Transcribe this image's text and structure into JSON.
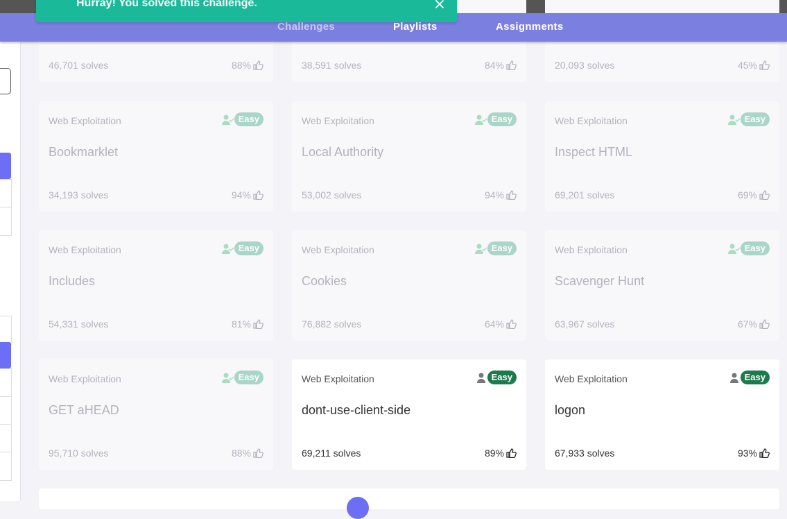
{
  "toast": {
    "message": "Hurray! You solved this challenge."
  },
  "nav": {
    "items": [
      {
        "label": "Challenges"
      },
      {
        "label": "Playlists"
      },
      {
        "label": "Assignments"
      }
    ]
  },
  "colors": {
    "nav_bg": "#7b7fe0",
    "toast_bg": "#1ab99a",
    "easy_badge": "#1e7a4c",
    "easy_badge_solved": "#a9d6c8",
    "accent": "#6c6ff5"
  },
  "top_row": [
    {
      "solves": "46,701 solves",
      "rating": "88%"
    },
    {
      "solves": "38,591 solves",
      "rating": "84%"
    },
    {
      "solves": "20,093 solves",
      "rating": "45%"
    }
  ],
  "cards": [
    {
      "category": "Web Exploitation",
      "name": "Bookmarklet",
      "difficulty": "Easy",
      "solves": "34,193 solves",
      "rating": "94%",
      "solved": true
    },
    {
      "category": "Web Exploitation",
      "name": "Local Authority",
      "difficulty": "Easy",
      "solves": "53,002 solves",
      "rating": "94%",
      "solved": true
    },
    {
      "category": "Web Exploitation",
      "name": "Inspect HTML",
      "difficulty": "Easy",
      "solves": "69,201 solves",
      "rating": "69%",
      "solved": true
    },
    {
      "category": "Web Exploitation",
      "name": "Includes",
      "difficulty": "Easy",
      "solves": "54,331 solves",
      "rating": "81%",
      "solved": true
    },
    {
      "category": "Web Exploitation",
      "name": "Cookies",
      "difficulty": "Easy",
      "solves": "76,882 solves",
      "rating": "64%",
      "solved": true
    },
    {
      "category": "Web Exploitation",
      "name": "Scavenger Hunt",
      "difficulty": "Easy",
      "solves": "63,967 solves",
      "rating": "67%",
      "solved": true
    },
    {
      "category": "Web Exploitation",
      "name": "GET aHEAD",
      "difficulty": "Easy",
      "solves": "95,710 solves",
      "rating": "88%",
      "solved": true
    },
    {
      "category": "Web Exploitation",
      "name": "dont-use-client-side",
      "difficulty": "Easy",
      "solves": "69,211 solves",
      "rating": "89%",
      "solved": false
    },
    {
      "category": "Web Exploitation",
      "name": "logon",
      "difficulty": "Easy",
      "solves": "67,933 solves",
      "rating": "93%",
      "solved": false
    }
  ],
  "icons": {
    "solved_user": "user-check-icon",
    "unsolved_user": "user-icon",
    "rating": "thumbs-up-icon",
    "close": "close-icon"
  }
}
